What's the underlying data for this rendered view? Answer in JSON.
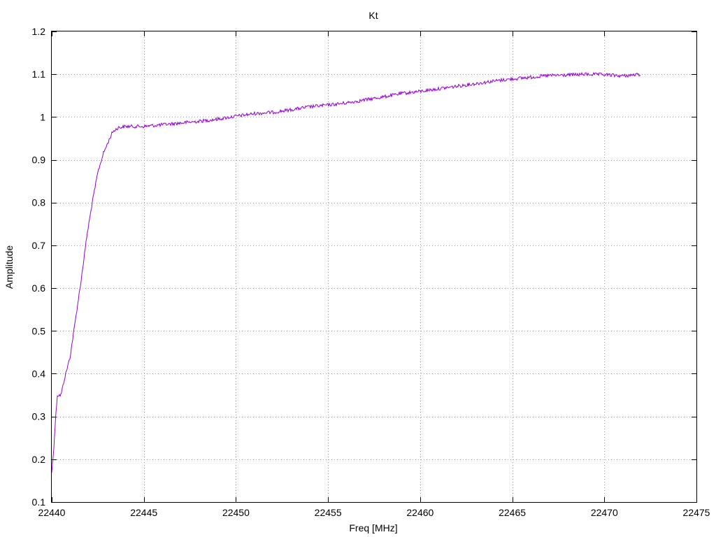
{
  "chart_data": {
    "type": "line",
    "title": "Kt",
    "xlabel": "Freq [MHz]",
    "ylabel": "Amplitude",
    "xlim": [
      22440,
      22475
    ],
    "ylim": [
      0.1,
      1.2
    ],
    "xticks": [
      22440,
      22445,
      22450,
      22455,
      22460,
      22465,
      22470,
      22475
    ],
    "xtick_labels": [
      "22440",
      "22445",
      "22450",
      "22455",
      "22460",
      "22465",
      "22470",
      "22475"
    ],
    "yticks": [
      0.1,
      0.2,
      0.3,
      0.4,
      0.5,
      0.6,
      0.7,
      0.8,
      0.9,
      1.0,
      1.1,
      1.2
    ],
    "ytick_labels": [
      "0.1",
      "0.2",
      "0.3",
      "0.4",
      "0.5",
      "0.6",
      "0.7",
      "0.8",
      "0.9",
      "1",
      "1.1",
      "1.2"
    ],
    "grid": true,
    "legend": "none",
    "series": [
      {
        "color": "#9400d3",
        "noise_amplitude": 0.004,
        "x": [
          22440.0,
          22440.1,
          22440.2,
          22440.3,
          22440.5,
          22440.7,
          22441.0,
          22441.3,
          22441.6,
          22441.9,
          22442.2,
          22442.5,
          22442.8,
          22443.0,
          22443.3,
          22443.6,
          22444.0,
          22444.5,
          22445.0,
          22446.0,
          22447.0,
          22448.0,
          22449.0,
          22450.0,
          22451.0,
          22452.0,
          22453.0,
          22454.0,
          22455.0,
          22456.0,
          22457.0,
          22458.0,
          22459.0,
          22460.0,
          22461.0,
          22462.0,
          22463.0,
          22464.0,
          22465.0,
          22466.0,
          22467.0,
          22468.0,
          22469.0,
          22470.0,
          22471.0,
          22472.0
        ],
        "y": [
          0.17,
          0.22,
          0.29,
          0.35,
          0.35,
          0.39,
          0.44,
          0.53,
          0.62,
          0.72,
          0.8,
          0.87,
          0.915,
          0.935,
          0.965,
          0.975,
          0.978,
          0.978,
          0.978,
          0.982,
          0.986,
          0.99,
          0.995,
          1.002,
          1.008,
          1.011,
          1.017,
          1.024,
          1.028,
          1.033,
          1.04,
          1.047,
          1.055,
          1.06,
          1.066,
          1.072,
          1.078,
          1.084,
          1.089,
          1.093,
          1.097,
          1.098,
          1.1,
          1.099,
          1.096,
          1.1
        ]
      }
    ]
  }
}
